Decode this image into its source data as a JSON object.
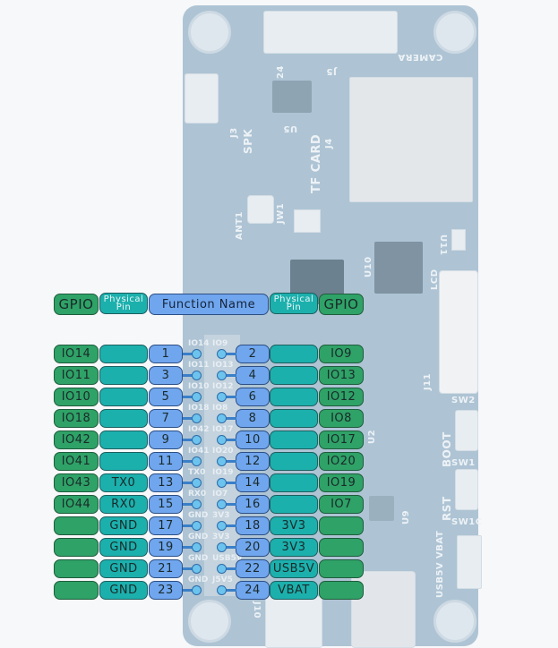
{
  "header": {
    "gpio_left": "GPIO",
    "physical_left": [
      "Physical",
      "Pin"
    ],
    "function_name": "Function Name",
    "physical_right": [
      "Physical",
      "Pin"
    ],
    "gpio_right": "GPIO"
  },
  "rows": [
    {
      "l_gpio": "IO14",
      "l_func": "",
      "l_pin": "1",
      "r_pin": "2",
      "r_func": "",
      "r_gpio": "IO9"
    },
    {
      "l_gpio": "IO11",
      "l_func": "",
      "l_pin": "3",
      "r_pin": "4",
      "r_func": "",
      "r_gpio": "IO13"
    },
    {
      "l_gpio": "IO10",
      "l_func": "",
      "l_pin": "5",
      "r_pin": "6",
      "r_func": "",
      "r_gpio": "IO12"
    },
    {
      "l_gpio": "IO18",
      "l_func": "",
      "l_pin": "7",
      "r_pin": "8",
      "r_func": "",
      "r_gpio": "IO8"
    },
    {
      "l_gpio": "IO42",
      "l_func": "",
      "l_pin": "9",
      "r_pin": "10",
      "r_func": "",
      "r_gpio": "IO17"
    },
    {
      "l_gpio": "IO41",
      "l_func": "",
      "l_pin": "11",
      "r_pin": "12",
      "r_func": "",
      "r_gpio": "IO20"
    },
    {
      "l_gpio": "IO43",
      "l_func": "TX0",
      "l_pin": "13",
      "r_pin": "14",
      "r_func": "",
      "r_gpio": "IO19"
    },
    {
      "l_gpio": "IO44",
      "l_func": "RX0",
      "l_pin": "15",
      "r_pin": "16",
      "r_func": "",
      "r_gpio": "IO7"
    },
    {
      "l_gpio": "",
      "l_func": "GND",
      "l_pin": "17",
      "r_pin": "18",
      "r_func": "3V3",
      "r_gpio": ""
    },
    {
      "l_gpio": "",
      "l_func": "GND",
      "l_pin": "19",
      "r_pin": "20",
      "r_func": "3V3",
      "r_gpio": ""
    },
    {
      "l_gpio": "",
      "l_func": "GND",
      "l_pin": "21",
      "r_pin": "22",
      "r_func": "USB5V",
      "r_gpio": ""
    },
    {
      "l_gpio": "",
      "l_func": "GND",
      "l_pin": "23",
      "r_pin": "24",
      "r_func": "VBAT",
      "r_gpio": ""
    }
  ],
  "board_silkscreen": {
    "camera": "CAMERA",
    "j5": "J5",
    "j4_label": "24",
    "spk": "SPK",
    "j3": "J3",
    "u5": "U5",
    "tf_card": "TF CARD",
    "j4": "J4",
    "ant1": "ANT1",
    "jw1": "JW1",
    "u10": "U10",
    "u11": "U11",
    "lcd": "LCD",
    "j11": "J11",
    "sw2": "SW2",
    "boot": "BOOT",
    "sw1": "SW1",
    "rst": "RST",
    "sw1c": "SW1C",
    "u9": "U9",
    "u2": "U2",
    "vbat": "VBAT",
    "usb5v": "USB5V",
    "j10": "J10",
    "header_pads": [
      [
        "IO14",
        "IO9"
      ],
      [
        "IO11",
        "IO13"
      ],
      [
        "IO10",
        "IO12"
      ],
      [
        "IO18",
        "IO8"
      ],
      [
        "IO42",
        "IO17"
      ],
      [
        "IO41",
        "IO20"
      ],
      [
        "TX0",
        "IO19"
      ],
      [
        "RX0",
        "IO7"
      ],
      [
        "GND",
        "3V3"
      ],
      [
        "GND",
        "3V3"
      ],
      [
        "GND",
        "USB5V"
      ],
      [
        "GND",
        "J5V5"
      ]
    ]
  },
  "colors": {
    "gpio": "#2fa267",
    "physical": "#1cb0ad",
    "pin_number": "#70a6ee",
    "board": "#aec4d4"
  }
}
